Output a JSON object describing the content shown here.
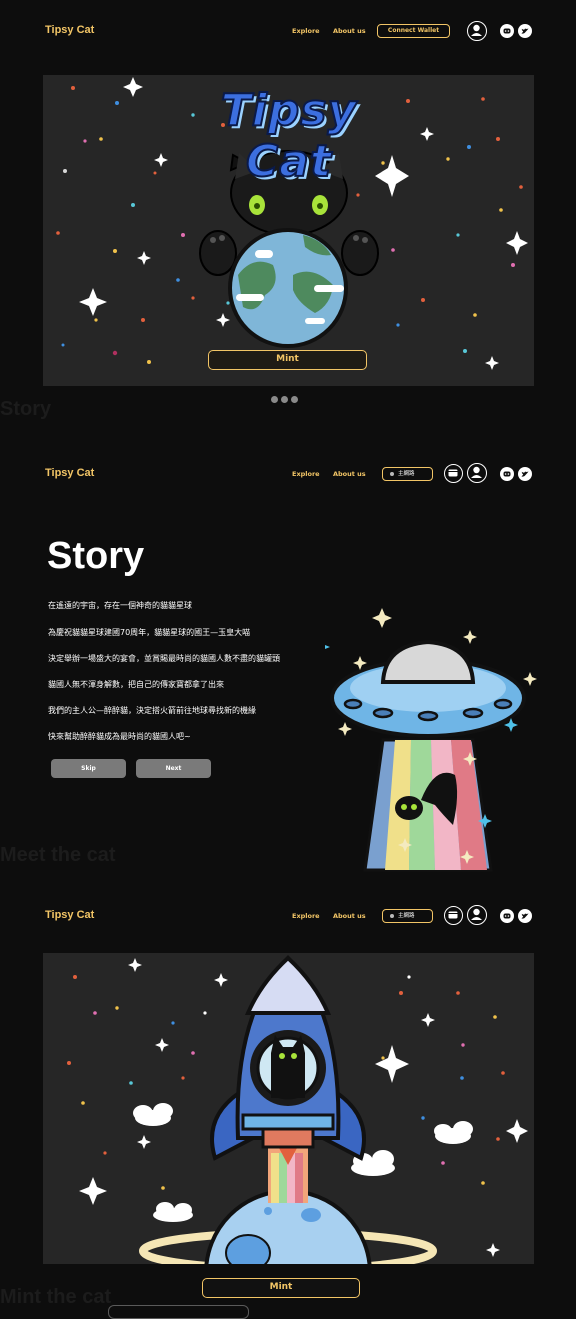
{
  "brand": "Tipsy Cat",
  "nav": {
    "explore": "Explore",
    "about": "About us",
    "connect": "Connect Wallet",
    "network": "主網路"
  },
  "hero": {
    "title": "Tipsy Cat",
    "mint": "Mint"
  },
  "story": {
    "heading": "Story",
    "lines": [
      "在遙遠的宇宙，存在一個神奇的貓貓星球",
      "為慶祝貓貓星球建國70周年，貓貓星球的國王—玉皇大喵",
      "決定舉辦一場盛大的宴會，並賞賜最時尚的貓國人數不盡的貓罐頭",
      "貓國人無不渾身解數，把自己的傳家寶都拿了出來",
      "我們的主人公—醉醉貓，決定搭火箭前往地球尋找新的機緣",
      "快來幫助醉醉貓成為最時尚的貓國人吧~"
    ],
    "skip": "Skip",
    "next": "Next"
  },
  "section3": {
    "mint": "Mint"
  },
  "ghost": {
    "a": "Story",
    "b": "Meet the cat",
    "c": "Mint the cat"
  },
  "colors": {
    "accent": "#f2c566",
    "bg": "#0d0d0d",
    "panel": "#262626"
  }
}
